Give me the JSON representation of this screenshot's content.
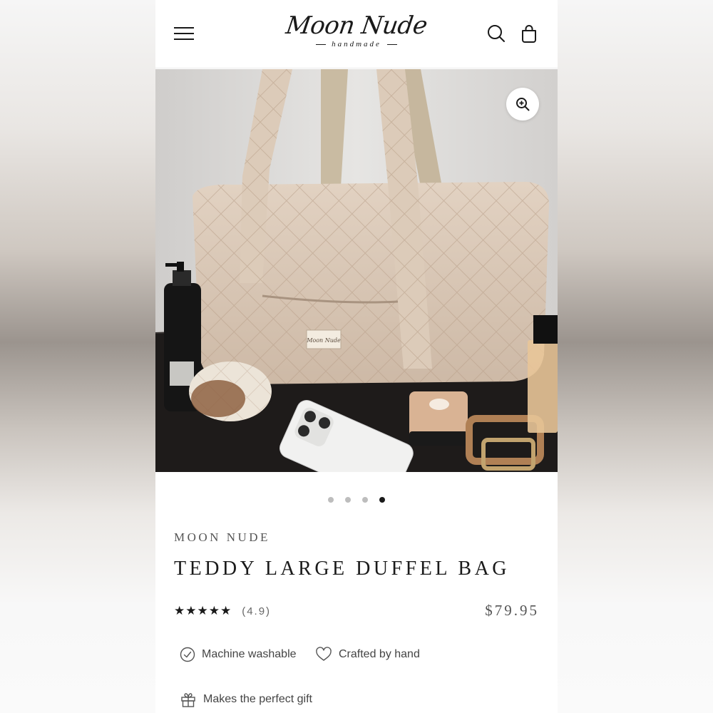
{
  "header": {
    "logo_script": "Moon Nude",
    "logo_sub": "handmade"
  },
  "gallery": {
    "total_images": 4,
    "active_index": 3,
    "label_tag_text": "Moon Nude"
  },
  "product": {
    "brand": "MOON NUDE",
    "title": "TEDDY LARGE DUFFEL BAG",
    "stars": "★★★★★",
    "rating_text": "(4.9)",
    "price": "$79.95"
  },
  "features": [
    {
      "label": "Machine washable",
      "icon": "check-circle-icon"
    },
    {
      "label": "Crafted by hand",
      "icon": "heart-icon"
    },
    {
      "label": "Makes the perfect gift",
      "icon": "gift-icon"
    }
  ],
  "colors": {
    "text": "#1a1a1a",
    "muted": "#555555",
    "dot_inactive": "#bdbdbd",
    "teddy_beige": "#d9c6b4"
  }
}
